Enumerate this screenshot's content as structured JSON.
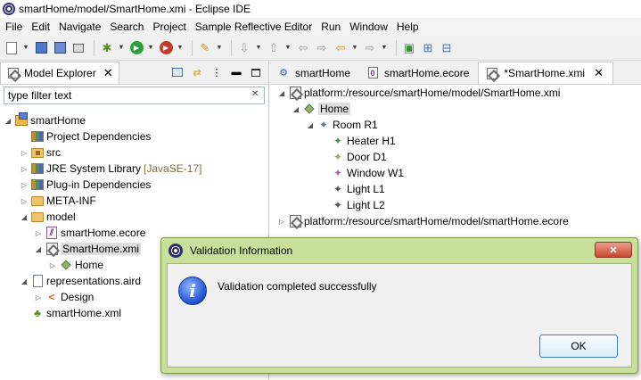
{
  "window": {
    "title": "smartHome/model/SmartHome.xmi - Eclipse IDE"
  },
  "menu": {
    "items": [
      "File",
      "Edit",
      "Navigate",
      "Search",
      "Project",
      "Sample Reflective Editor",
      "Run",
      "Window",
      "Help"
    ]
  },
  "left_view": {
    "tab_label": "Model Explorer",
    "filter_placeholder": "type filter text",
    "tree": [
      {
        "label": "smartHome"
      },
      {
        "label": "Project Dependencies"
      },
      {
        "label": "src"
      },
      {
        "label": "JRE System Library",
        "decoration": "[JavaSE-17]"
      },
      {
        "label": "Plug-in Dependencies"
      },
      {
        "label": "META-INF"
      },
      {
        "label": "model"
      },
      {
        "label": "smartHome.ecore"
      },
      {
        "label": "SmartHome.xmi"
      },
      {
        "label": "Home"
      },
      {
        "label": "representations.aird"
      },
      {
        "label": "Design"
      },
      {
        "label": "smartHome.xml"
      }
    ]
  },
  "editor": {
    "tabs": [
      {
        "label": "smartHome"
      },
      {
        "label": "smartHome.ecore"
      },
      {
        "label": "*SmartHome.xmi"
      }
    ],
    "tree": [
      {
        "label": "platform:/resource/smartHome/model/SmartHome.xmi"
      },
      {
        "label": "Home"
      },
      {
        "label": "Room R1"
      },
      {
        "label": "Heater H1"
      },
      {
        "label": "Door D1"
      },
      {
        "label": "Window W1"
      },
      {
        "label": "Light L1"
      },
      {
        "label": "Light L2"
      },
      {
        "label": "platform:/resource/smartHome/model/smartHome.ecore"
      }
    ]
  },
  "dialog": {
    "title": "Validation Information",
    "message": "Validation completed successfully",
    "ok_label": "OK"
  },
  "colors": {
    "dialog_frame": "#c8e09a",
    "selection": "#dedede",
    "close_button": "#c8452d"
  }
}
